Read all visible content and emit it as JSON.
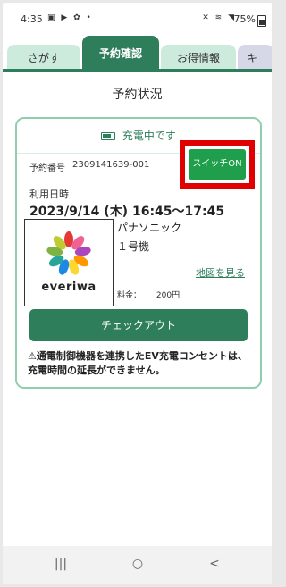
{
  "status_bar": {
    "time": "4:35",
    "left_icons": "▣ ▶ ✿ •",
    "right_icons": "✕ ≋ ◥",
    "battery": "75%"
  },
  "tabs": [
    {
      "label": "さがす"
    },
    {
      "label": "予約確認"
    },
    {
      "label": "お得情報"
    },
    {
      "label": "キ"
    }
  ],
  "page_title": "予約状況",
  "card": {
    "charging_status": "充電中です",
    "reservation_label": "予約番号",
    "reservation_number": "2309141639-001",
    "switch_button": "スイッチON",
    "datetime_label": "利用日時",
    "datetime": "2023/9/14 (木) 16:45～17:45",
    "logo_text": "everiwa",
    "store_name": "パナソニック",
    "unit": "１号機",
    "map_link": "地図を見る",
    "price_label": "料金：",
    "price_value": "200円",
    "checkout_button": "チェックアウト",
    "notice": "⚠通電制御機器を連携したEV充電コンセントは、充電時間の延長ができません。"
  },
  "navbar": {
    "recent": "|||",
    "home": "○",
    "back": "<"
  },
  "colors": {
    "brand_green": "#2e7d5b",
    "tab_green_light": "#cdebdc",
    "switch_green": "#1f9e4c",
    "highlight_red": "#e00000"
  }
}
